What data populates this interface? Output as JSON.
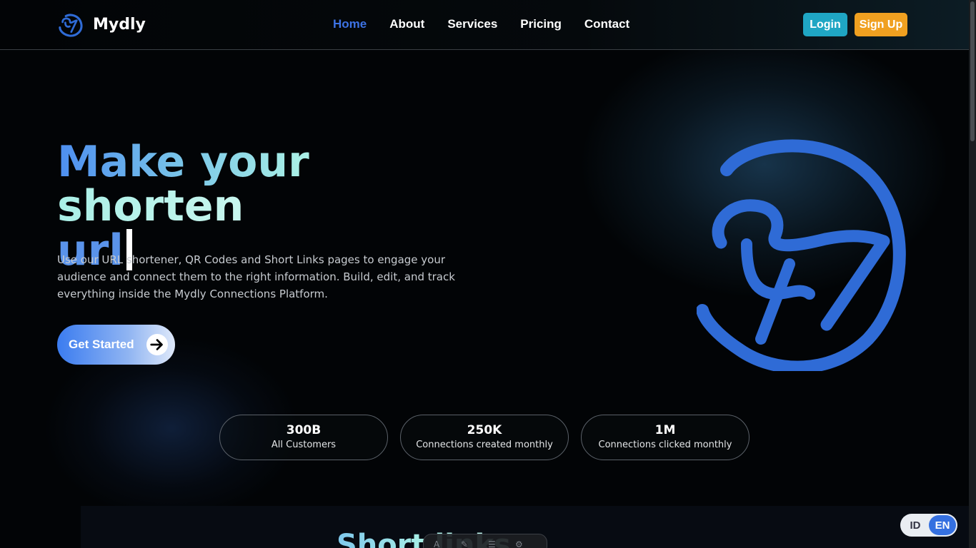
{
  "header": {
    "brand": "Mydly",
    "nav": [
      {
        "label": "Home",
        "active": true
      },
      {
        "label": "About"
      },
      {
        "label": "Services"
      },
      {
        "label": "Pricing"
      },
      {
        "label": "Contact"
      }
    ],
    "login_label": "Login",
    "signup_label": "Sign Up"
  },
  "hero": {
    "title_line1": "Make your shorten",
    "title_line2": "url",
    "description": "Use our URL shortener, QR Codes and Short Links pages to engage your audience and connect them to the right information. Build, edit, and track everything inside the Mydly Connections Platform.",
    "cta_label": "Get Started",
    "cta_icon": "arrow-right-icon",
    "logo_icon": "mydly-logo-icon"
  },
  "stats": [
    {
      "value": "300B",
      "label": "All Customers"
    },
    {
      "value": "250K",
      "label": "Connections created monthly"
    },
    {
      "value": "1M",
      "label": "Connections clicked monthly"
    }
  ],
  "section2": {
    "title": "Short   links"
  },
  "language": {
    "options": [
      "ID",
      "EN"
    ],
    "selected": "EN"
  },
  "colors": {
    "accent": "#3d72e4",
    "login": "#1fa6c4",
    "signup": "#f0a020",
    "logo_blue": "#2f6bd6"
  }
}
